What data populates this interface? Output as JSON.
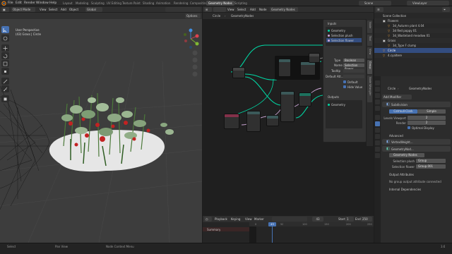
{
  "top_menu": [
    "File",
    "Edit",
    "Render",
    "Window",
    "Help"
  ],
  "workspaces": [
    "Layout",
    "Modeling",
    "Sculpting",
    "UV Editing",
    "Texture Paint",
    "Shading",
    "Animation",
    "Rendering",
    "Compositing",
    "Geometry Nodes",
    "Scripting"
  ],
  "active_workspace": "Geometry Nodes",
  "scene": "Scene",
  "view_layer": "ViewLayer",
  "viewport": {
    "mode": "Object Mode",
    "menus": [
      "View",
      "Select",
      "Add",
      "Object"
    ],
    "orientation": "Global",
    "options": "Options",
    "perspective": "User Perspective",
    "object_info": "(43) Grass | Circle"
  },
  "node_editor": {
    "object": "Circle",
    "tree": "GeometryNodes",
    "tree2": "Geometry Nodes",
    "menus": [
      "View",
      "Select",
      "Add",
      "Node"
    ],
    "panel": {
      "inputs_title": "Inputs",
      "inputs": [
        "Geometry",
        "Selection plush",
        "Selection flower"
      ],
      "type_label": "Type",
      "type_value": "Boolean",
      "name_label": "Name",
      "name_value": "Selection flower",
      "tooltip_label": "Tooltip",
      "default_label": "Default Att...",
      "default_check": "Default",
      "hide_value": "Hide Value",
      "outputs_title": "Outputs",
      "outputs": [
        "Geometry"
      ]
    },
    "side_tabs": [
      "Node",
      "Tool",
      "View",
      "Group",
      "Node Wrangler"
    ]
  },
  "timeline": {
    "menus": [
      "Playback",
      "Keying",
      "View",
      "Marker"
    ],
    "current_frame": "43",
    "start_label": "Start",
    "start": "1",
    "end_label": "End",
    "end": "250",
    "summary": "Summary",
    "ruler": [
      "0",
      "50",
      "100",
      "150",
      "200",
      "250"
    ]
  },
  "outliner": {
    "rows": [
      {
        "label": "Scene Collection"
      },
      {
        "label": "Flowers"
      },
      {
        "label": "3d_Autumn plant 4.04"
      },
      {
        "label": "3d Red poppy 01"
      },
      {
        "label": "3d_Wasteland meadow 01"
      },
      {
        "label": "Grass"
      },
      {
        "label": "3d_Type F clump"
      },
      {
        "label": "Circle"
      },
      {
        "label": "4.cyaltere"
      }
    ],
    "selected_index": 7
  },
  "properties": {
    "object": "Circle",
    "tree": "GeometryNodes",
    "add_modifier": "Add Modifier",
    "modifiers": [
      {
        "name": "Subdivision"
      },
      {
        "name": "VertexWeight..."
      },
      {
        "name": "GeometryNod..."
      }
    ],
    "subdiv_tabs": [
      "Catmull-Clark",
      "Simple"
    ],
    "levels_label": "Levels Viewport",
    "levels_value": "2",
    "render_label": "Render",
    "render_value": "2",
    "optimal_display": "Optimal Display",
    "advanced": "Advanced",
    "gn_tree": "Geometry Nodes",
    "sel_plush_label": "Selection plush",
    "sel_plush_value": "Group",
    "sel_flower_label": "Selection flower",
    "sel_flower_value": "Group.001",
    "output_attributes": "Output Attributes",
    "no_output": "No group output attribute connected",
    "internal_deps": "Internal Dependencies"
  },
  "status": {
    "left": "Select",
    "mid1": "Pan View",
    "mid2": "Node Context Menu",
    "version": "3.6"
  },
  "colors": {
    "accent": "#4772b3",
    "geometry_link": "#00d6a3",
    "bool_link": "#cca6d6",
    "group_node": "#3b5959",
    "attr_node": "#1d725e",
    "input_node": "#83314a",
    "frame_indicator": "#4772b3"
  }
}
